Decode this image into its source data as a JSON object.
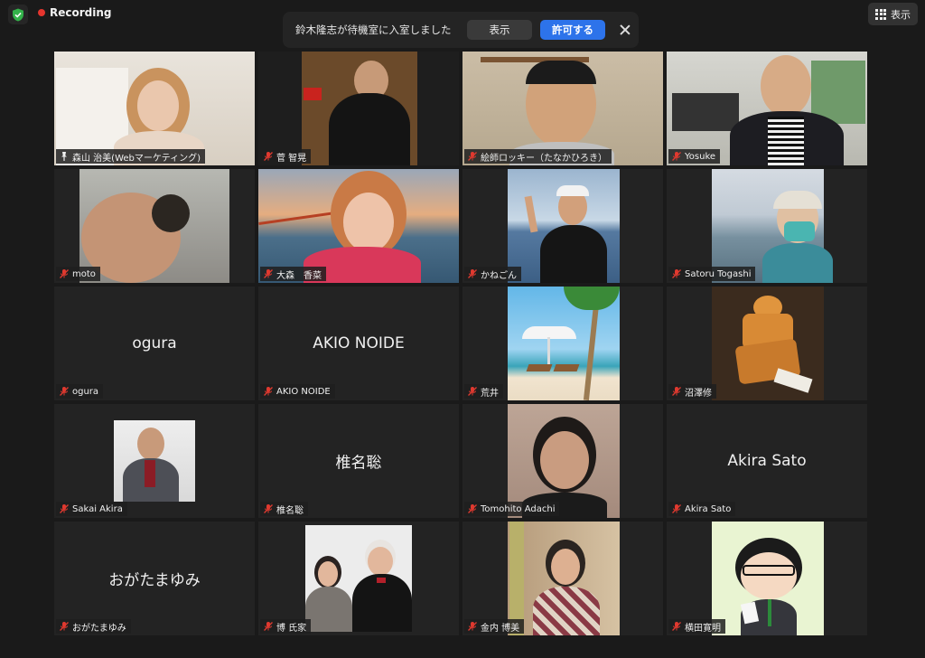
{
  "topbar": {
    "recording_label": "Recording",
    "view_label": "表示"
  },
  "notification": {
    "message": "鈴木隆志が待機室に入室しました",
    "show_label": "表示",
    "admit_label": "許可する"
  },
  "participants": [
    {
      "name": "森山 治美(Webマーケティング)",
      "video": true,
      "muted": false,
      "active": true
    },
    {
      "name": "菅 智晃",
      "video": true,
      "muted": true
    },
    {
      "name": "絵師ロッキー（たなかひろき）",
      "video": true,
      "muted": true
    },
    {
      "name": "Yosuke",
      "video": true,
      "muted": true
    },
    {
      "name": "moto",
      "video": true,
      "muted": true
    },
    {
      "name": "大森　香菜",
      "video": true,
      "muted": true
    },
    {
      "name": "かねごん",
      "video": true,
      "muted": true
    },
    {
      "name": "Satoru Togashi",
      "video": true,
      "muted": true
    },
    {
      "name": "ogura",
      "video": false,
      "display": "ogura",
      "muted": true
    },
    {
      "name": "AKIO NOIDE",
      "video": false,
      "display": "AKIO NOIDE",
      "muted": true
    },
    {
      "name": "荒井",
      "video": true,
      "muted": true
    },
    {
      "name": "沼澤修",
      "video": true,
      "muted": true
    },
    {
      "name": "Sakai Akira",
      "video": true,
      "muted": true
    },
    {
      "name": "椎名聡",
      "video": false,
      "display": "椎名聡",
      "muted": true
    },
    {
      "name": "Tomohito Adachi",
      "video": true,
      "muted": true
    },
    {
      "name": "Akira Sato",
      "video": false,
      "display": "Akira Sato",
      "muted": true
    },
    {
      "name": "おがたまゆみ",
      "video": false,
      "display": "おがたまゆみ",
      "muted": true
    },
    {
      "name": "博 氏家",
      "video": true,
      "muted": true
    },
    {
      "name": "金内 博美",
      "video": true,
      "muted": true
    },
    {
      "name": "横田寛明",
      "video": true,
      "muted": true
    }
  ],
  "colors": {
    "recording_dot": "#e5352e",
    "admit_button": "#2d73ea",
    "active_speaker_border": "#d7e77d",
    "muted_icon": "#e0392f"
  }
}
